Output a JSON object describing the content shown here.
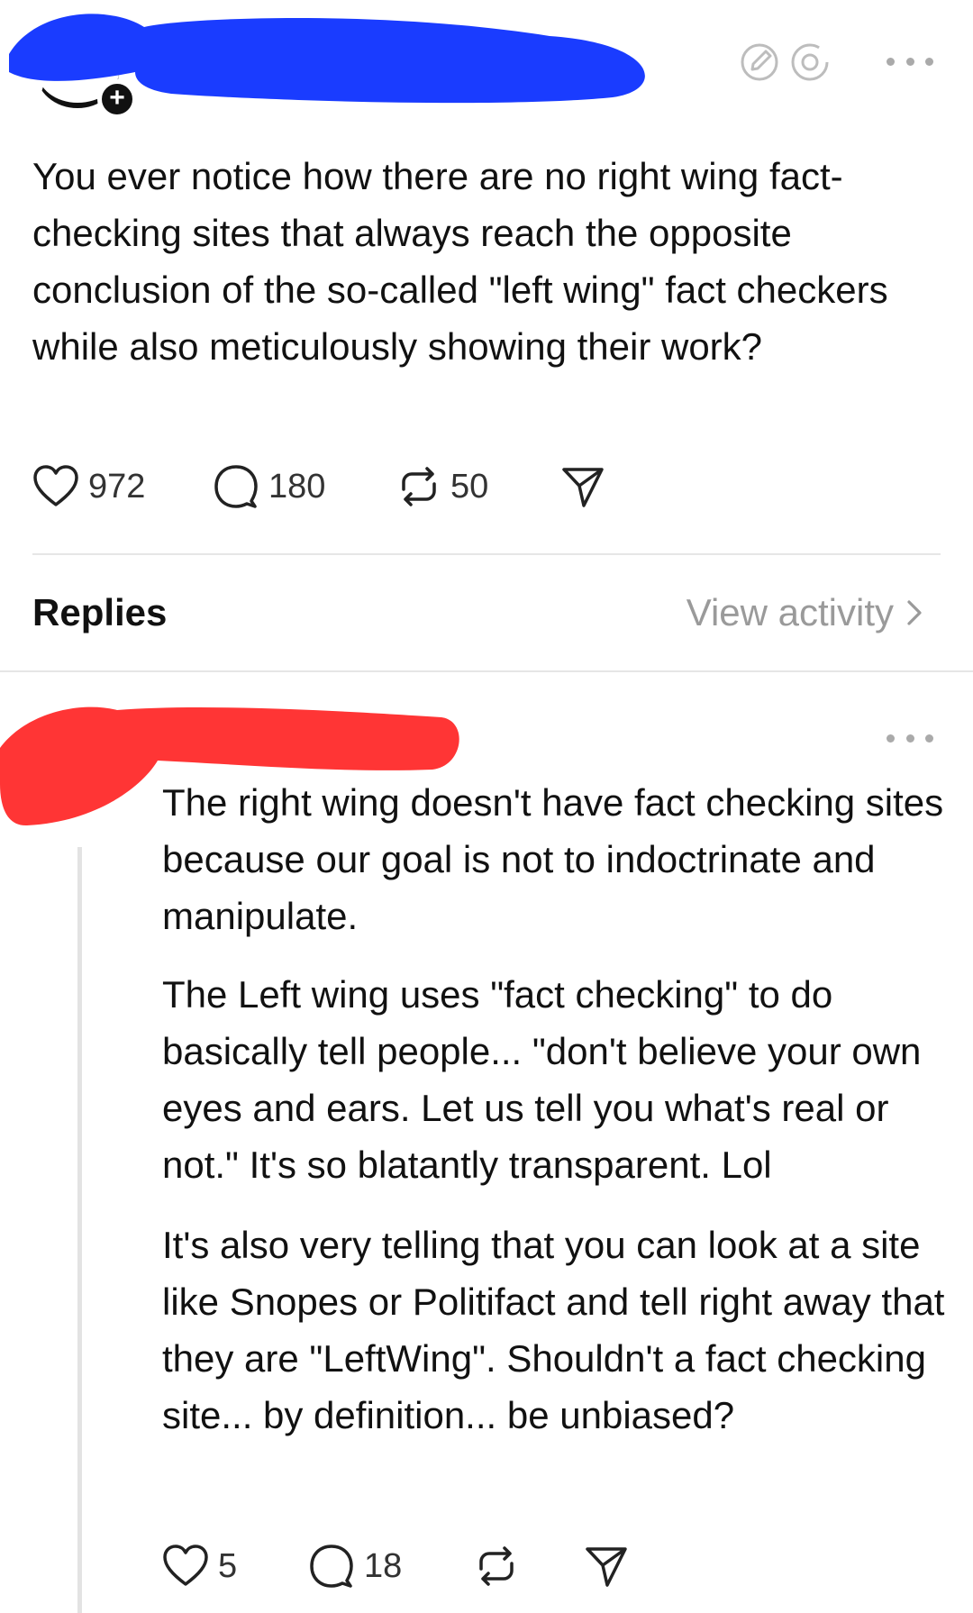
{
  "post": {
    "text": "You ever notice how there are no right wing fact-checking sites that always reach the opposite conclusion of the so-called \"left wing\" fact checkers while also meticulously showing their work?",
    "likes": "972",
    "comments": "180",
    "reposts": "50"
  },
  "replies_section": {
    "label": "Replies",
    "view_activity": "View activity"
  },
  "reply": {
    "paragraphs": [
      "The right wing doesn't have fact checking sites because our goal is not to indoctrinate and manipulate.",
      "The Left wing uses \"fact checking\" to do basically tell people... \"don't believe your own eyes and ears. Let us tell you what's real or not.\" It's so blatantly transparent. Lol",
      "It's also very telling that you can look at a site like Snopes or Politifact and tell right away that they are \"LeftWing\". Shouldn't a fact checking site... by definition... be unbiased?"
    ],
    "likes": "5",
    "comments": "18"
  },
  "icons": {
    "header": [
      "edit-note-icon",
      "threads-logo-icon",
      "more-icon"
    ],
    "post_actions": [
      "heart-icon",
      "comment-icon",
      "repost-icon",
      "share-icon"
    ]
  },
  "colors": {
    "redaction_blue": "#1a3cff",
    "redaction_red": "#ff3535",
    "muted_text": "#9a9a9a"
  }
}
